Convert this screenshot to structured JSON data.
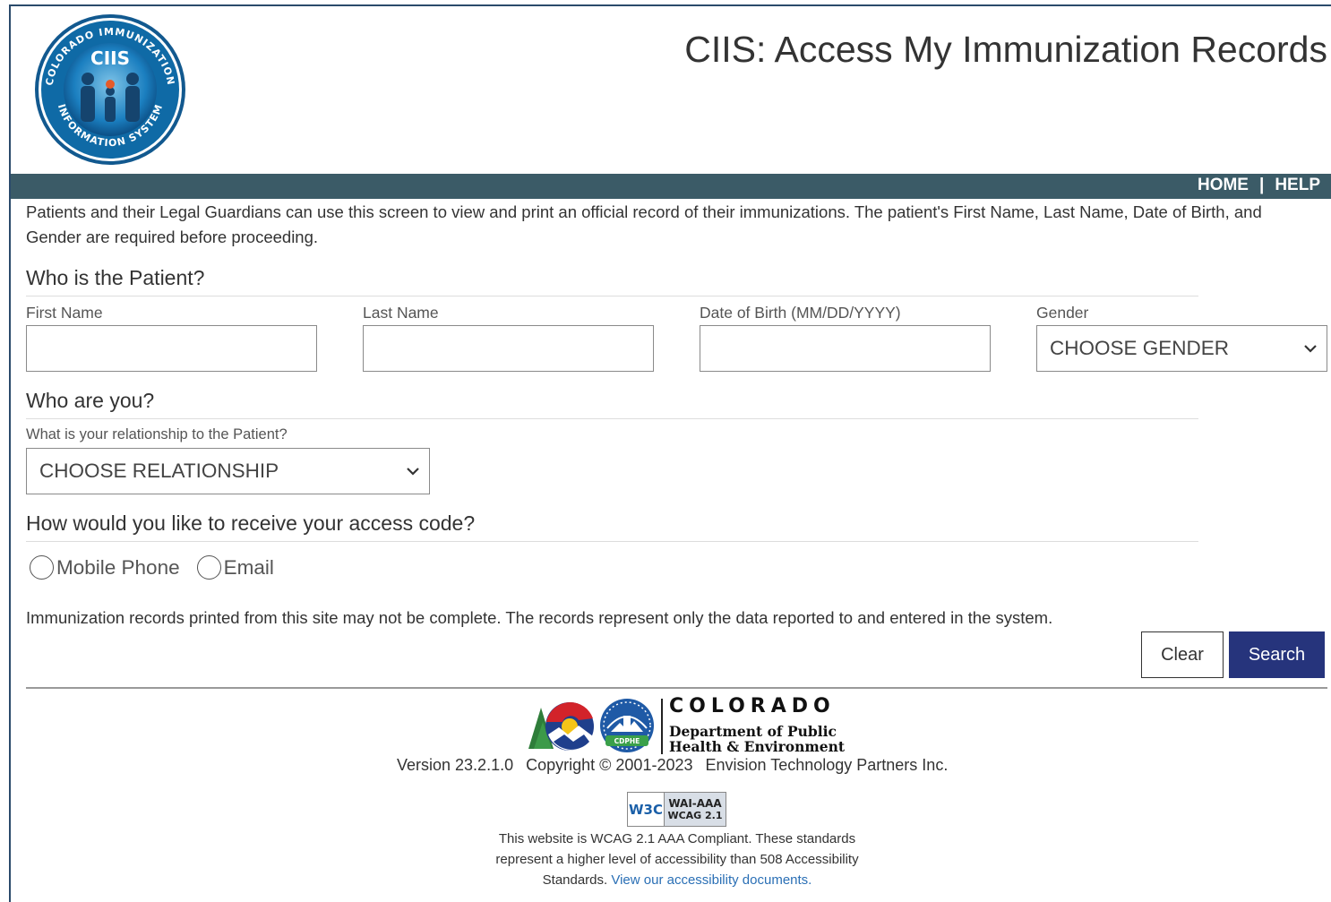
{
  "header": {
    "title": "CIIS: Access My Immunization Records",
    "seal_text": {
      "top": "COLORADO IMMUNIZATION",
      "bottom": "INFORMATION SYSTEM",
      "center": "CIIS"
    }
  },
  "nav": {
    "home": "HOME",
    "separator": "|",
    "help": "HELP"
  },
  "intro": "Patients and their Legal Guardians can use this screen to view and print an official record of their immunizations. The patient's First Name, Last Name, Date of Birth, and Gender are required before proceeding.",
  "patient_section": {
    "title": "Who is the Patient?",
    "first_name_label": "First Name",
    "first_name_value": "",
    "last_name_label": "Last Name",
    "last_name_value": "",
    "dob_label": "Date of Birth (MM/DD/YYYY)",
    "dob_value": "",
    "gender_label": "Gender",
    "gender_selected": "CHOOSE GENDER"
  },
  "you_section": {
    "title": "Who are you?",
    "relationship_label": "What is your relationship to the Patient?",
    "relationship_selected": "CHOOSE RELATIONSHIP"
  },
  "access_section": {
    "title": "How would you like to receive your access code?",
    "options": [
      "Mobile Phone",
      "Email"
    ]
  },
  "notice": "Immunization records printed from this site may not be complete. The records represent only the data reported to and entered in the system.",
  "buttons": {
    "clear": "Clear",
    "search": "Search"
  },
  "footer": {
    "colorado": "COLORADO",
    "dept_line1": "Department of Public",
    "dept_line2": "Health & Environment",
    "cdphe": "CDPHE",
    "version": "Version 23.2.1.0",
    "copyright": "Copyright © 2001-2023",
    "company": "Envision Technology Partners Inc.",
    "w3c_badge": {
      "w3c": "W3C",
      "line1": "WAI-AAA",
      "line2": "WCAG 2.1"
    },
    "wcag_text": "This website is WCAG 2.1 AAA Compliant. These standards represent a higher level of accessibility than 508 Accessibility Standards.",
    "wcag_link": "View our accessibility documents."
  },
  "colors": {
    "navbar": "#3b5b67",
    "search_button": "#26347c",
    "link": "#2a6fb5",
    "frame": "#2a4a6b"
  }
}
